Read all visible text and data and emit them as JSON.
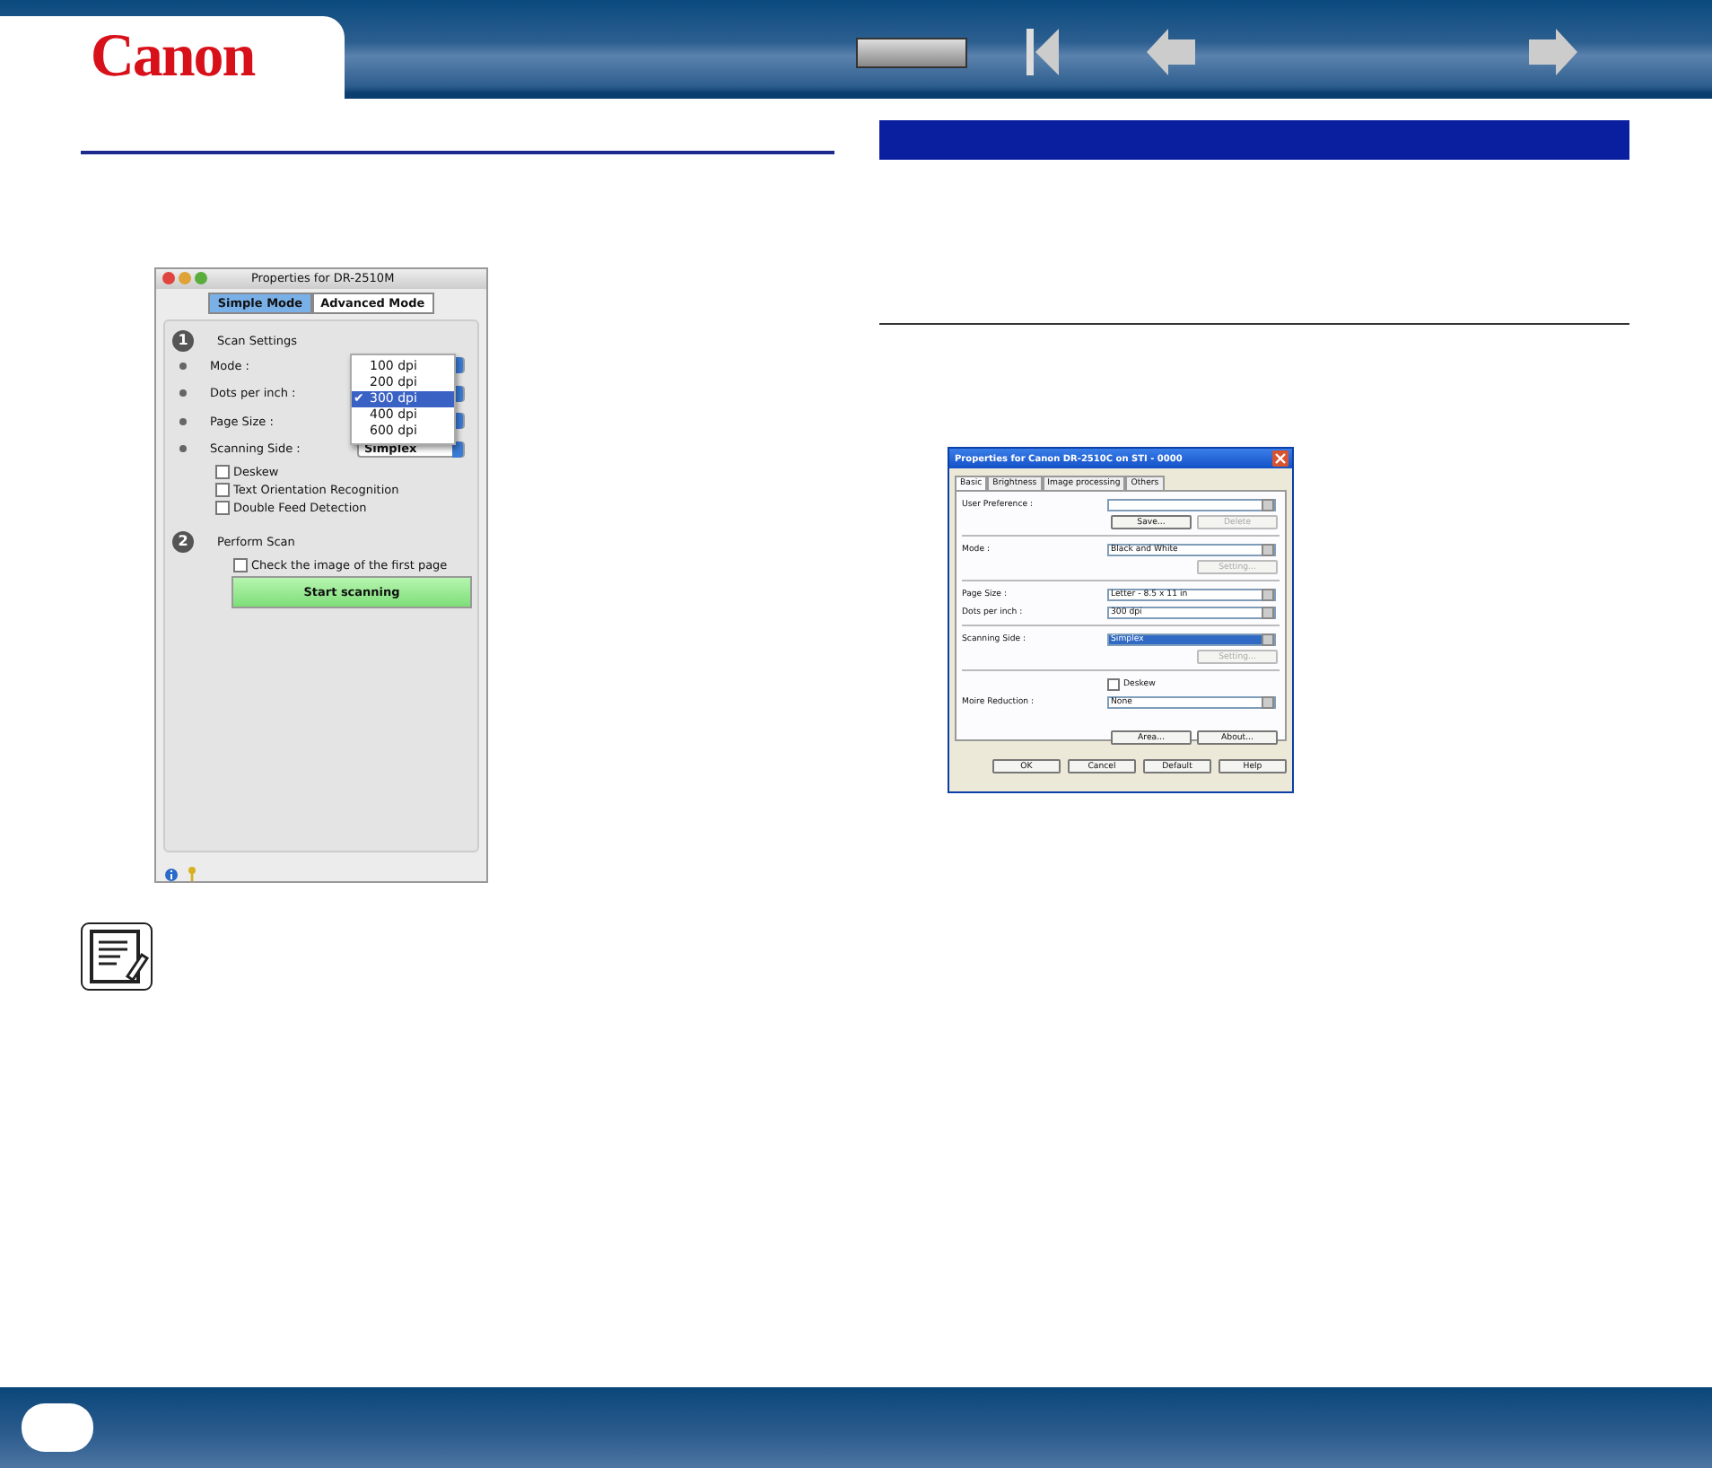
{
  "header": {
    "logo": "Canon"
  },
  "mac_dialog": {
    "title": "Properties for DR-2510M",
    "modes": [
      {
        "label": "Simple Mode",
        "selected": true
      },
      {
        "label": "Advanced Mode",
        "selected": false
      }
    ],
    "step1": {
      "number": "1",
      "title": "Scan Settings"
    },
    "settings": [
      {
        "label": "Mode :"
      },
      {
        "label": "Dots per inch :"
      },
      {
        "label": "Page Size :"
      },
      {
        "label": "Scanning Side :",
        "value": "Simplex"
      }
    ],
    "check_mark": "✔",
    "dpi_menu": [
      {
        "label": "100 dpi",
        "selected": false
      },
      {
        "label": "200 dpi",
        "selected": false
      },
      {
        "label": "300 dpi",
        "selected": true
      },
      {
        "label": "400 dpi",
        "selected": false
      },
      {
        "label": "600 dpi",
        "selected": false
      }
    ],
    "checkboxes": [
      {
        "label": "Deskew",
        "checked": false
      },
      {
        "label": "Text Orientation Recognition",
        "checked": false
      },
      {
        "label": "Double Feed Detection",
        "checked": false
      }
    ],
    "step2": {
      "number": "2",
      "title": "Perform Scan"
    },
    "preview_checkbox": {
      "label": "Check the image of the first page",
      "checked": false
    },
    "scan_button": "Start scanning"
  },
  "win_dialog": {
    "title": "Properties for Canon DR-2510C on STI - 0000",
    "tabs": [
      {
        "label": "Basic",
        "selected": true
      },
      {
        "label": "Brightness",
        "selected": false
      },
      {
        "label": "Image processing",
        "selected": false
      },
      {
        "label": "Others",
        "selected": false
      }
    ],
    "rows": [
      {
        "kind": "select",
        "label": "User Preference :",
        "highlighted": false
      },
      {
        "kind": "buttons",
        "buttons": [
          {
            "label": "Save...",
            "disabled": false
          },
          {
            "label": "Delete",
            "disabled": true
          }
        ]
      },
      {
        "kind": "divider"
      },
      {
        "kind": "select",
        "label": "Mode :",
        "value": "Black and White",
        "highlighted": false
      },
      {
        "kind": "buttons",
        "buttons": [
          {
            "label": "Setting...",
            "disabled": true
          }
        ]
      },
      {
        "kind": "divider"
      },
      {
        "kind": "select",
        "label": "Page Size :",
        "value": "Letter - 8.5 x 11 in",
        "highlighted": false
      },
      {
        "kind": "select",
        "label": "Dots per inch :",
        "value": "300 dpi",
        "highlighted": false
      },
      {
        "kind": "divider"
      },
      {
        "kind": "select",
        "label": "Scanning Side :",
        "value": "Simplex",
        "highlighted": true
      },
      {
        "kind": "buttons",
        "buttons": [
          {
            "label": "Setting...",
            "disabled": true
          }
        ]
      },
      {
        "kind": "divider"
      },
      {
        "kind": "checkbox",
        "label": "Deskew",
        "checked": false
      },
      {
        "kind": "select",
        "label": "Moire Reduction :",
        "value": "None",
        "highlighted": false
      },
      {
        "kind": "spacer"
      },
      {
        "kind": "buttons",
        "buttons": [
          {
            "label": "Area...",
            "disabled": false
          },
          {
            "label": "About...",
            "disabled": false
          }
        ]
      }
    ],
    "footer_buttons": [
      "OK",
      "Cancel",
      "Default",
      "Help"
    ]
  }
}
